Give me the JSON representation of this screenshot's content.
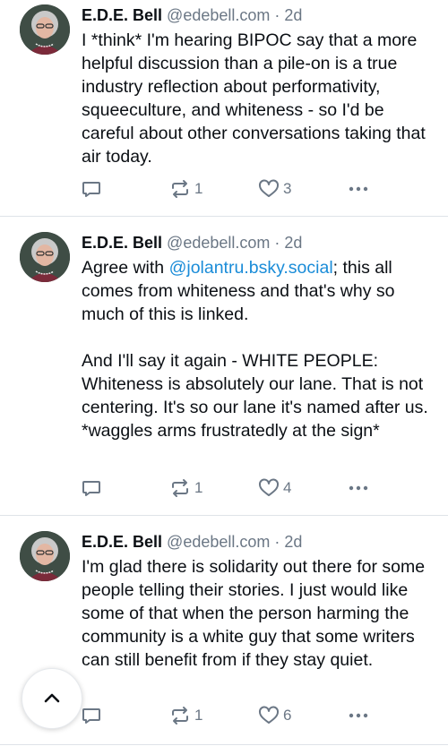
{
  "posts": [
    {
      "author": "E.D.E. Bell",
      "handle": "@edebell.com",
      "separator": "·",
      "time": "2d",
      "text": "I *think* I'm hearing BIPOC say that a more helpful discussion than a pile-on is a true industry reflection about performativity, squeeculture, and whiteness - so I'd be careful about other conversations taking that air today.",
      "reposts": "1",
      "likes": "3"
    },
    {
      "author": "E.D.E. Bell",
      "handle": "@edebell.com",
      "separator": "·",
      "time": "2d",
      "text_before": "Agree with ",
      "mention": "@jolantru.bsky.social",
      "text_after": "; this all comes from whiteness and that's why so much of this is linked.\n\nAnd I'll say it again - WHITE PEOPLE: Whiteness is absolutely our lane. That is not centering. It's so our lane it's named after us. *waggles arms frustratedly at the sign*",
      "reposts": "1",
      "likes": "4"
    },
    {
      "author": "E.D.E. Bell",
      "handle": "@edebell.com",
      "separator": "·",
      "time": "2d",
      "text": "I'm glad there is solidarity out there for some people telling their stories. I just would like some of that when the person harming the community is a white guy that some writers can still benefit from if they stay quiet.",
      "reposts": "1",
      "likes": "6"
    }
  ],
  "icons": {
    "reply": "reply-icon",
    "repost": "repost-icon",
    "like": "heart-icon",
    "more": "more-icon",
    "scroll_top": "chevron-up-icon"
  },
  "colors": {
    "text": "#0b0f14",
    "muted": "#6b7785",
    "link": "#1a8cd8",
    "divider": "#dfe3e8"
  }
}
